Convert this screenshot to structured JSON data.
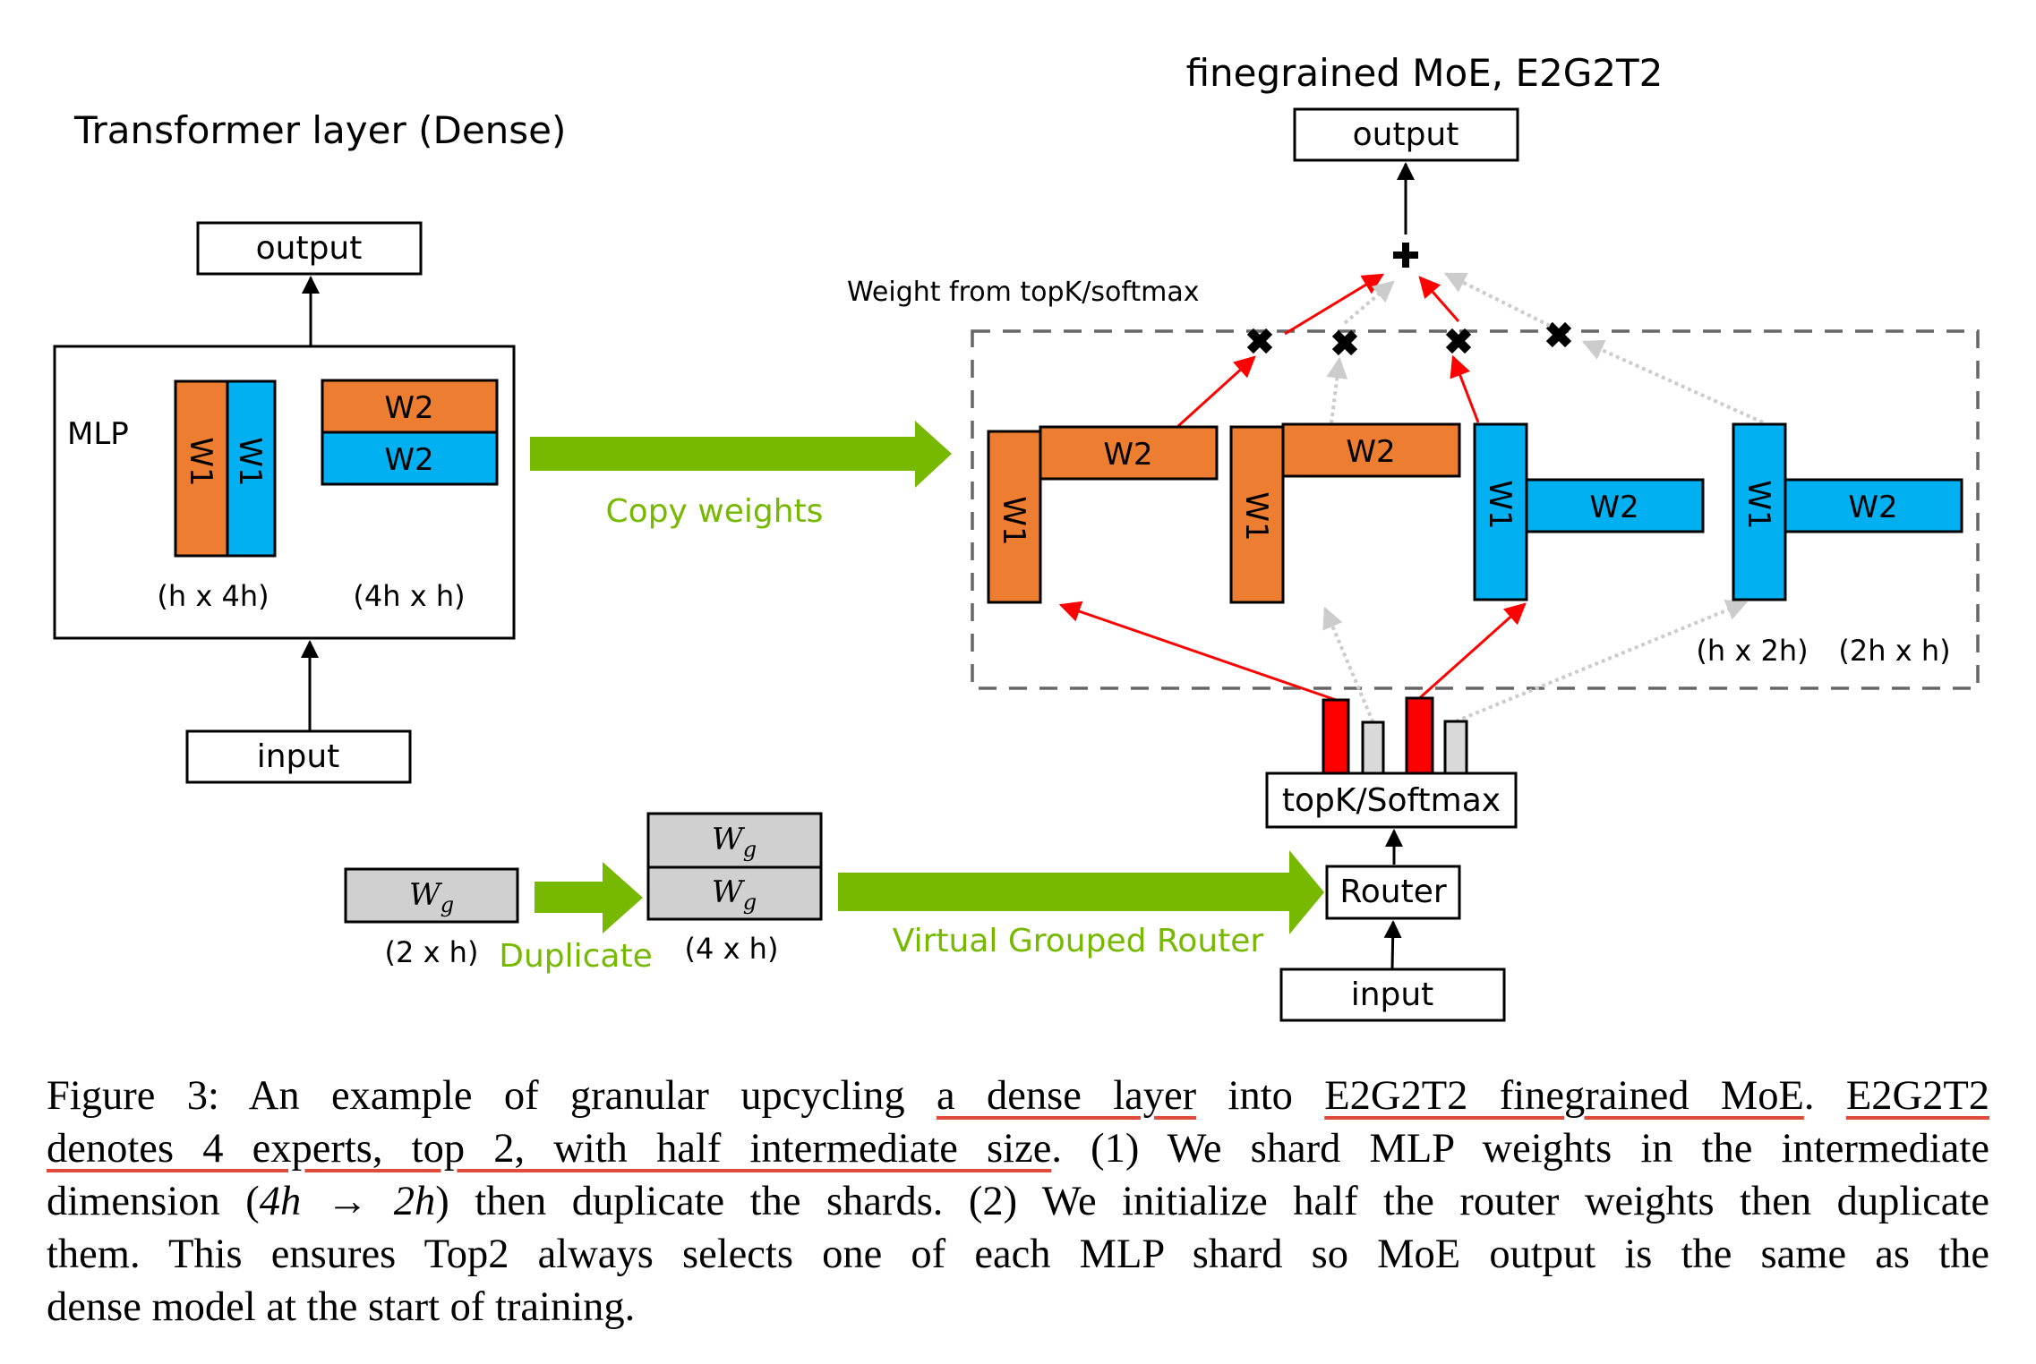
{
  "dense": {
    "title": "Transformer layer (Dense)",
    "output_label": "output",
    "input_label": "input",
    "mlp_label": "MLP",
    "w1_label": "W1",
    "w2_label": "W2",
    "w1_dims": "(h x 4h)",
    "w2_dims": "(4h x h)"
  },
  "copy_arrow": {
    "label": "Copy weights"
  },
  "moe": {
    "title": "finegrained MoE, E2G2T2",
    "output_label": "output",
    "weight_note": "Weight from topK/softmax",
    "experts": [
      {
        "w1": "W1",
        "w2": "W2",
        "color": "#ED7D31",
        "selected": true
      },
      {
        "w1": "W1",
        "w2": "W2",
        "color": "#ED7D31",
        "selected": false
      },
      {
        "w1": "W1",
        "w2": "W2",
        "color": "#00B0F0",
        "selected": true
      },
      {
        "w1": "W1",
        "w2": "W2",
        "color": "#00B0F0",
        "selected": false
      }
    ],
    "w1_dims": "(h x 2h)",
    "w2_dims": "(2h x h)",
    "topk_label": "topK/Softmax",
    "router_label": "Router",
    "input_label": "input",
    "router_scores": [
      {
        "state": "selected",
        "color": "#FF0000"
      },
      {
        "state": "unselected",
        "color": "#D9D9D9"
      },
      {
        "state": "selected",
        "color": "#FF0000"
      },
      {
        "state": "unselected",
        "color": "#D9D9D9"
      }
    ]
  },
  "router_init": {
    "wg_label": "W",
    "wg_sub": "g",
    "wg_dims": "(2 x h)",
    "duplicate_label": "Duplicate",
    "stacked_dims": "(4 x h)",
    "virtual_label": "Virtual Grouped Router"
  },
  "colors": {
    "orange": "#ED7D31",
    "blue": "#00B0F0",
    "green": "#76B900",
    "red": "#FF0000",
    "gray_fill": "#D0D0D0",
    "gray_arrow": "#CCCCCC",
    "dash": "#666666",
    "underline": "#E04A3A"
  },
  "caption": {
    "lines": [
      [
        "Figure 3:  An example of granular upcycling ",
        {
          "u": "a dense layer"
        },
        " into ",
        {
          "u": "E2G2T2 finegrained MoE"
        },
        ". ",
        {
          "u": "E2G2T2"
        }
      ],
      [
        {
          "u": "denotes 4 experts, top 2, with half intermediate size"
        },
        ".  (1) We shard MLP weights in the intermediate"
      ],
      [
        "dimension (",
        {
          "m": "4h"
        },
        " → ",
        {
          "m": "2h"
        },
        ") then duplicate the shards.  (2) We initialize half the router weights then duplicate"
      ],
      [
        "them.  This ensures Top2 always selects one of each MLP shard so MoE output is the same as the"
      ],
      [
        "dense model at the start of training."
      ]
    ]
  }
}
